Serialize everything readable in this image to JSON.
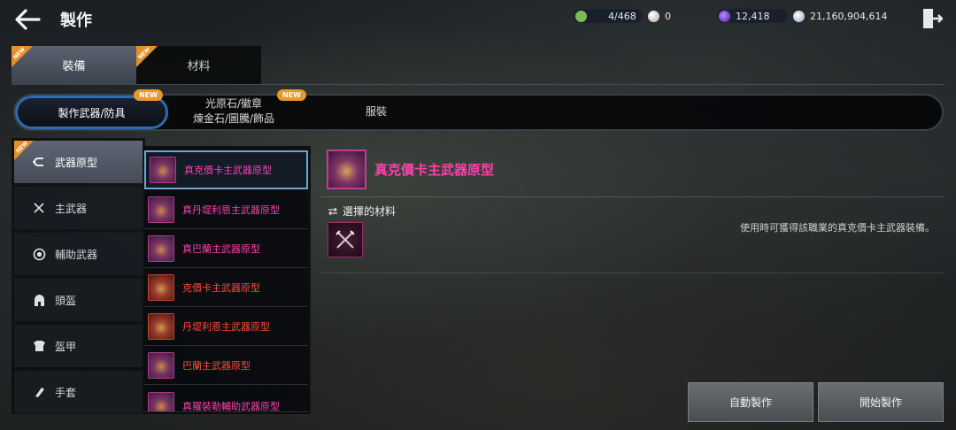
{
  "header": {
    "title": "製作",
    "back_icon": "arrow-left-icon",
    "exit_icon": "exit-door-icon"
  },
  "resources": [
    {
      "name": "bag-icon",
      "value": "4/468",
      "color": "#7dbb57"
    },
    {
      "name": "pearl-icon",
      "value": "0",
      "color": "#d8c8c8"
    },
    {
      "name": "purple-gem-icon",
      "value": "12,418",
      "color": "#7a3cff"
    },
    {
      "name": "silver-coin-icon",
      "value": "21,160,904,614",
      "color": "#cfd8e4"
    }
  ],
  "main_tabs": [
    {
      "label": "裝備",
      "active": true,
      "badge": "NEW"
    },
    {
      "label": "材料",
      "active": false,
      "badge": "NEW"
    }
  ],
  "sub_tabs": [
    {
      "label": "製作武器/防具",
      "active": true,
      "badge": "NEW"
    },
    {
      "label_line1": "光原石/徽章",
      "label_line2": "煉金石/圖騰/飾品",
      "active": false,
      "badge": "NEW"
    },
    {
      "label": "服裝",
      "active": false
    }
  ],
  "categories": [
    {
      "label": "武器原型",
      "icon": "return-arrow-icon",
      "active": true,
      "badge": "NEW"
    },
    {
      "label": "主武器",
      "icon": "crossed-swords-icon",
      "active": false
    },
    {
      "label": "輔助武器",
      "icon": "target-circle-icon",
      "active": false
    },
    {
      "label": "頭盔",
      "icon": "helmet-icon",
      "active": false
    },
    {
      "label": "盔甲",
      "icon": "armor-icon",
      "active": false
    },
    {
      "label": "手套",
      "icon": "glove-icon",
      "active": false
    }
  ],
  "items": [
    {
      "label": "真克價卡主武器原型",
      "color": "pink",
      "selected": true
    },
    {
      "label": "真丹堤利恩主武器原型",
      "color": "pink",
      "selected": false
    },
    {
      "label": "真巴蘭主武器原型",
      "color": "pink",
      "selected": false
    },
    {
      "label": "克價卡主武器原型",
      "color": "red",
      "selected": false
    },
    {
      "label": "丹堤利恩主武器原型",
      "color": "red",
      "selected": false
    },
    {
      "label": "巴蘭主武器原型",
      "color": "red",
      "selected": false
    },
    {
      "label": "真羅裝勒輔助武器原型",
      "color": "pink",
      "selected": false
    }
  ],
  "detail": {
    "title": "真克價卡主武器原型",
    "materials_label": "選擇的材料",
    "material_icon": "crossed-swords-icon",
    "description": "使用時可獲得該職業的真克價卡主武器裝備。"
  },
  "actions": {
    "auto_craft": "自動製作",
    "start_craft": "開始製作"
  },
  "colors": {
    "accent_blue": "#2e6bb0",
    "item_pink": "#ff3fb0",
    "item_red": "#ff4a3a",
    "badge_orange": "#e3912a"
  }
}
